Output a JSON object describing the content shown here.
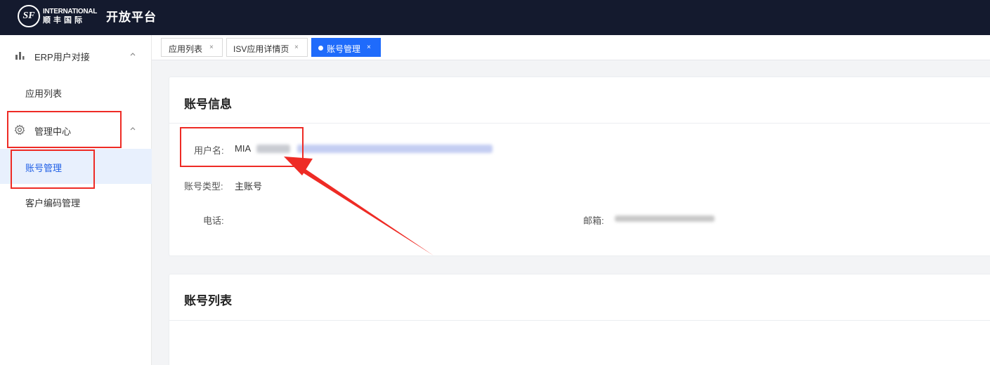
{
  "header": {
    "logo_mark": "SF",
    "logo_en": "INTERNATIONAL",
    "logo_zh": "顺丰国际",
    "title": "开放平台"
  },
  "sidebar": {
    "groups": [
      {
        "label": "ERP用户对接",
        "icon": "bar-chart-icon"
      },
      {
        "label": "管理中心",
        "icon": "gear-icon"
      }
    ],
    "items": [
      {
        "label": "应用列表"
      },
      {
        "label": "账号管理",
        "active": true
      },
      {
        "label": "客户编码管理"
      }
    ]
  },
  "tabs": [
    {
      "label": "应用列表",
      "close": "×"
    },
    {
      "label": "ISV应用详情页",
      "close": "×"
    },
    {
      "label": "账号管理",
      "close": "×",
      "active": true
    }
  ],
  "account_info": {
    "title": "账号信息",
    "username_label": "用户名:",
    "username_value": "MIA",
    "type_label": "账号类型:",
    "type_value": "主账号",
    "phone_label": "电话:",
    "email_label": "邮箱:"
  },
  "account_list": {
    "title": "账号列表"
  },
  "colors": {
    "header_bg": "#141a2e",
    "accent": "#1f6bfb",
    "annotation_red": "#ee2b25",
    "active_menu_bg": "#e8f0fd"
  }
}
